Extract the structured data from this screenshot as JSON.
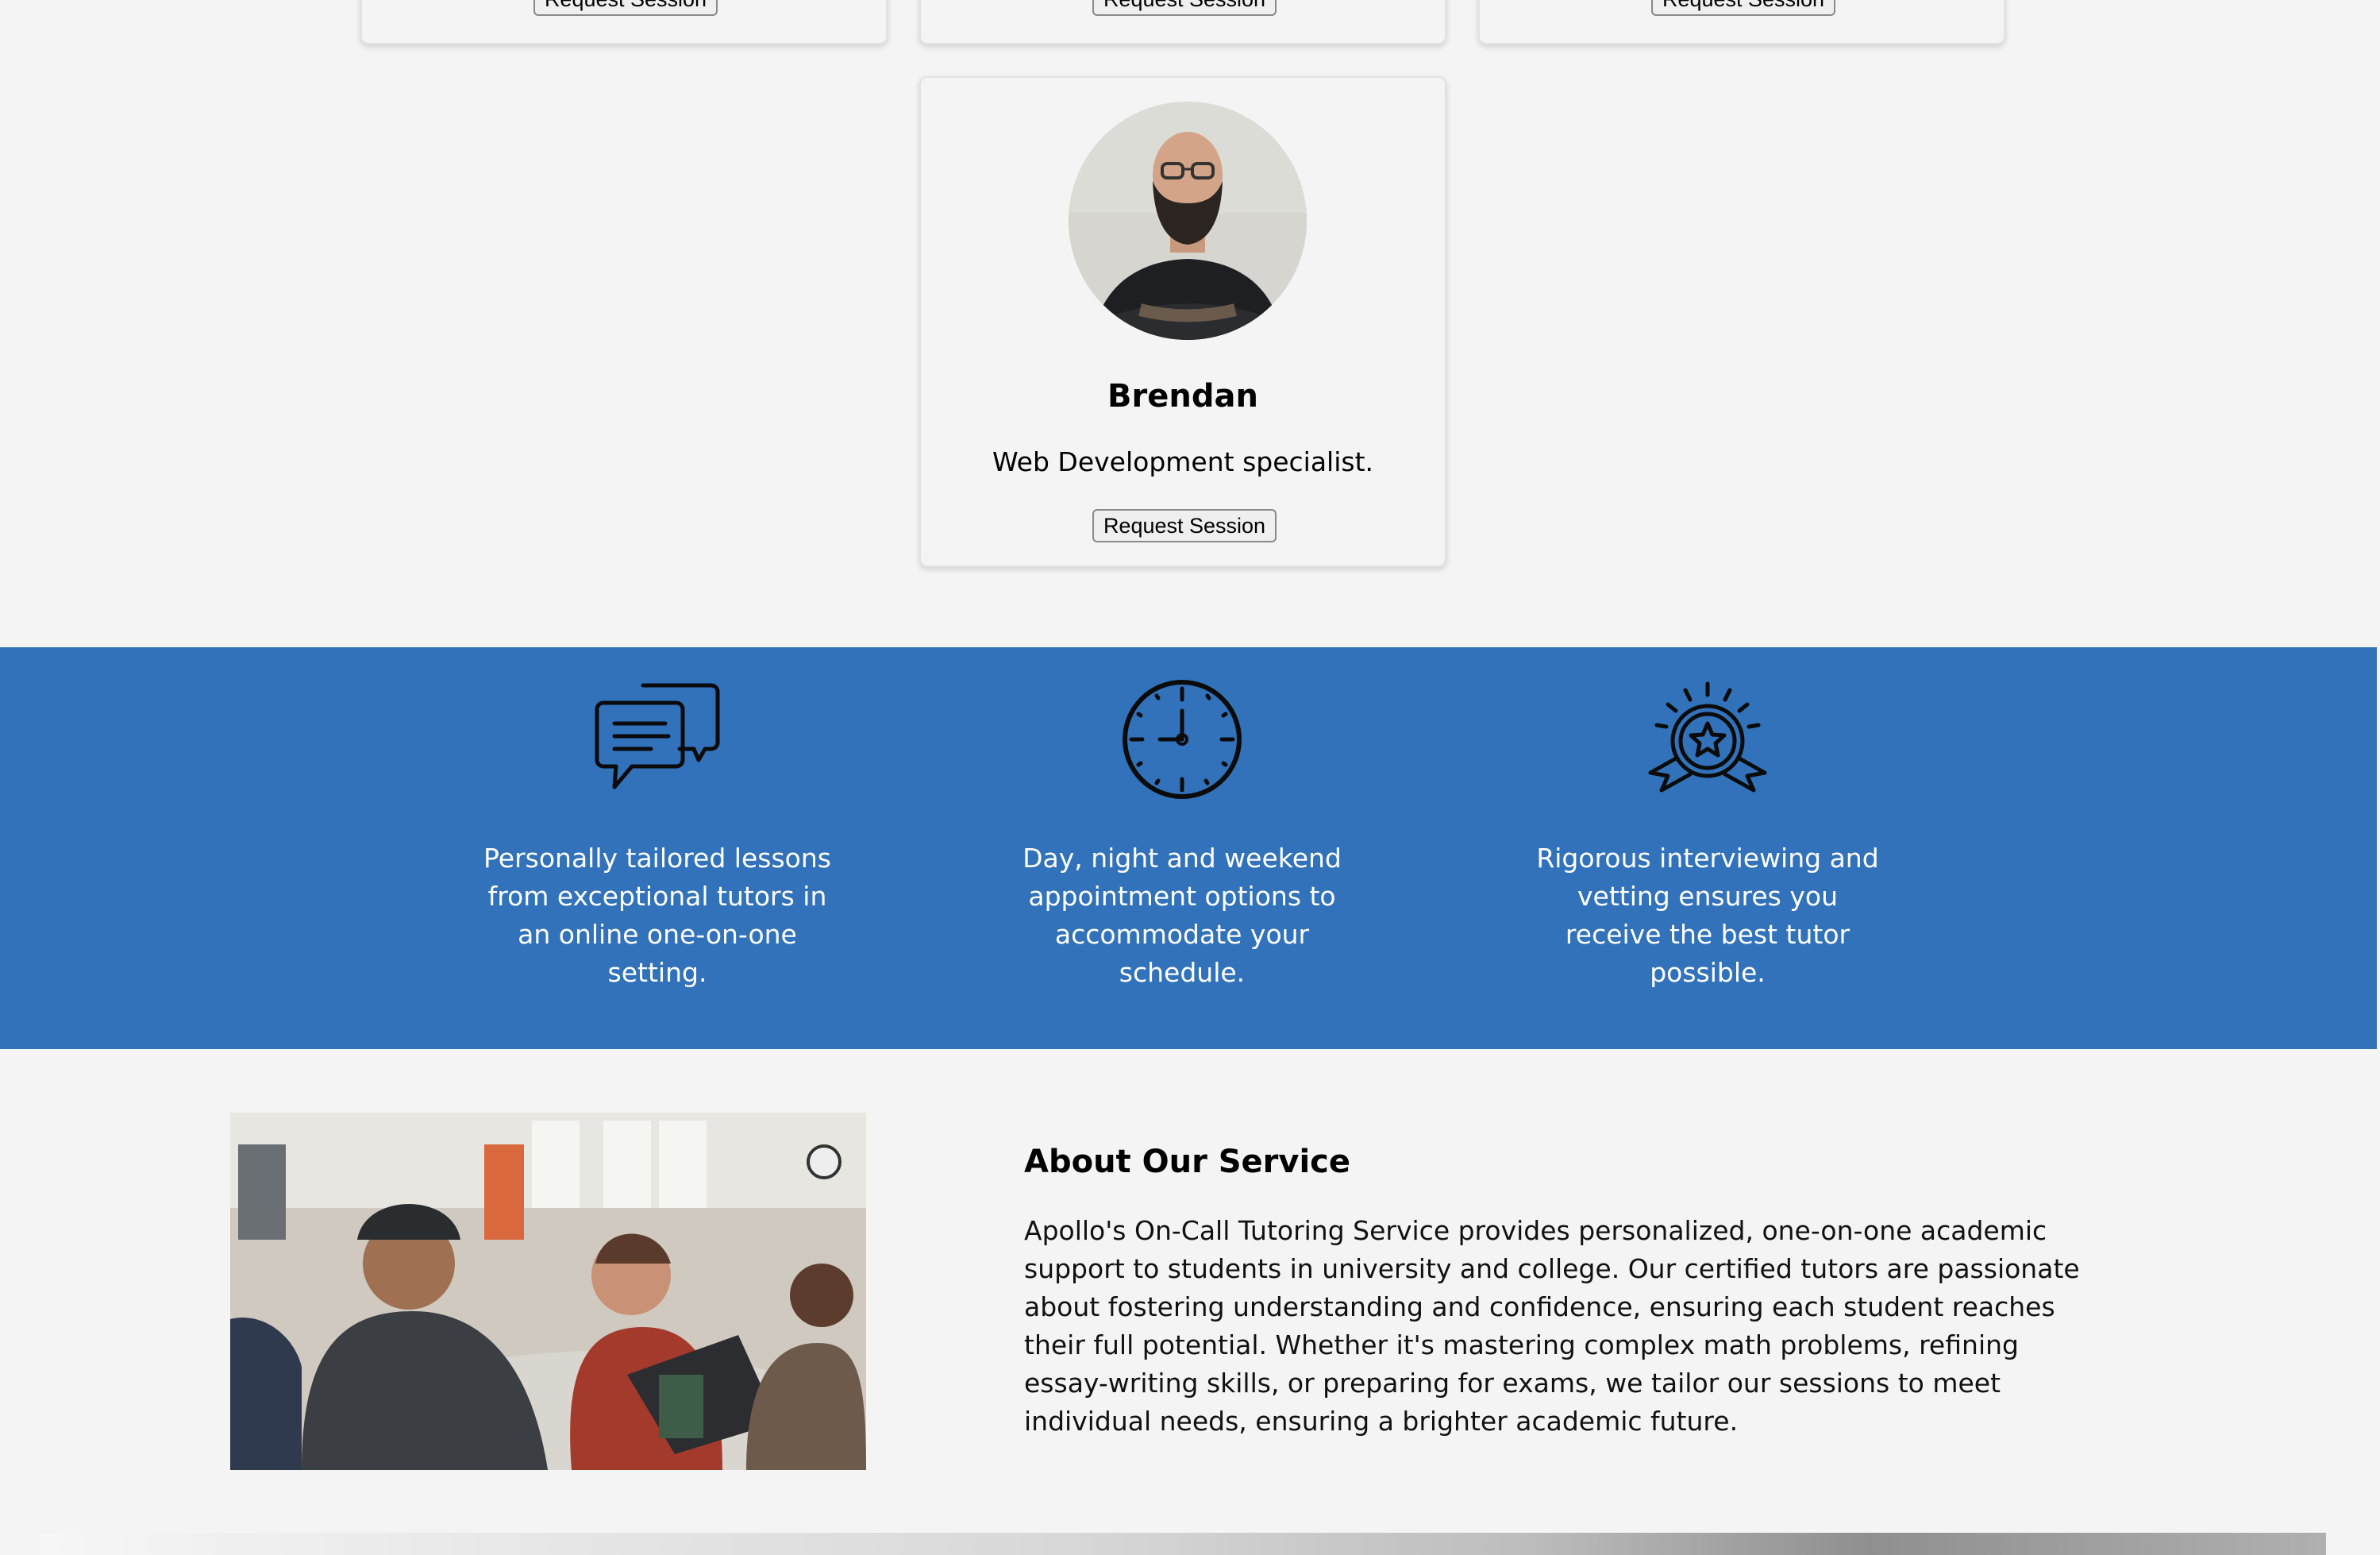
{
  "tutor_cards_top": [
    {
      "button_label": "Request Session"
    },
    {
      "button_label": "Request Session"
    },
    {
      "button_label": "Request Session"
    }
  ],
  "featured_tutor": {
    "name": "Brendan",
    "description": "Web Development specialist.",
    "button_label": "Request Session"
  },
  "features": [
    {
      "icon": "chat-bubbles-icon",
      "text": "Personally tailored lessons from exceptional tutors in an online one-on-one setting."
    },
    {
      "icon": "clock-icon",
      "text": "Day, night and weekend appointment options to accommodate your schedule."
    },
    {
      "icon": "award-badge-icon",
      "text": "Rigorous interviewing and vetting ensures you receive the best tutor possible."
    }
  ],
  "about": {
    "title": "About Our Service",
    "body": "Apollo's On-Call Tutoring Service provides personalized, one-on-one academic support to students in university and college. Our certified tutors are passionate about fostering understanding and confidence, ensuring each student reaches their full potential. Whether it's mastering complex math problems, refining essay-writing skills, or preparing for exams, we tailor our sessions to meet individual needs, ensuring a brighter academic future."
  },
  "colors": {
    "band": "#3172bb",
    "background": "#f4f4f4"
  }
}
